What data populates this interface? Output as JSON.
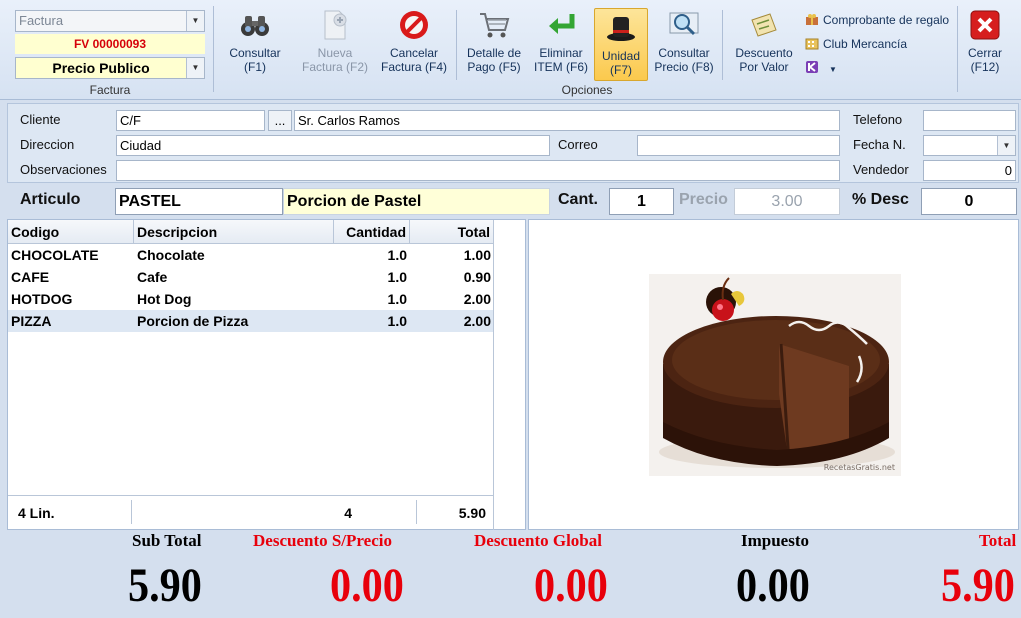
{
  "colors": {
    "accent_red": "#e8000b",
    "ribbon_bg": "#dbe6f4",
    "selected_button": "#fbd363"
  },
  "factura": {
    "doc_type": "Factura",
    "number": "FV 00000093",
    "price_list": "Precio Publico",
    "group_label": "Factura"
  },
  "toolbar": {
    "consultar": "Consultar\n(F1)",
    "nueva": "Nueva\nFactura (F2)",
    "cancelar": "Cancelar\nFactura (F4)",
    "detalle": "Detalle de\nPago (F5)",
    "eliminar": "Eliminar\nITEM (F6)",
    "unidad": "Unidad\n(F7)",
    "consultar_precio": "Consultar\nPrecio (F8)",
    "descuento": "Descuento\nPor Valor",
    "comprobante": "Comprobante de regalo",
    "club": "Club Mercancía",
    "cerrar": "Cerrar\n(F12)",
    "group_label": "Opciones",
    "icons": [
      "binoculars-icon",
      "new-document-icon",
      "cancel-icon",
      "cart-icon",
      "undo-arrow-icon",
      "top-hat-icon",
      "magnifier-icon",
      "discount-ticket-icon",
      "gift-icon",
      "building-icon",
      "k-logo-icon",
      "close-icon"
    ]
  },
  "client": {
    "cliente_label": "Cliente",
    "cliente_code": "C/F",
    "browse": "...",
    "cliente_name": "Sr. Carlos Ramos",
    "direccion_label": "Direccion",
    "direccion": "Ciudad",
    "correo_label": "Correo",
    "correo": "",
    "observaciones_label": "Observaciones",
    "observaciones": "",
    "telefono_label": "Telefono",
    "telefono": "",
    "fecha_label": "Fecha N.",
    "fecha": "",
    "vendedor_label": "Vendedor",
    "vendedor": "0"
  },
  "article": {
    "label": "Articulo",
    "code": "PASTEL",
    "description": "Porcion de Pastel",
    "cant_label": "Cant.",
    "cant": "1",
    "precio_label": "Precio",
    "precio": "3.00",
    "desc_label": "% Desc",
    "desc": "0"
  },
  "grid": {
    "headers": [
      "Codigo",
      "Descripcion",
      "Cantidad",
      "Total"
    ],
    "rows": [
      [
        "CHOCOLATE",
        "Chocolate",
        "1.0",
        "1.00"
      ],
      [
        "CAFE",
        "Cafe",
        "1.0",
        "0.90"
      ],
      [
        "HOTDOG",
        "Hot Dog",
        "1.0",
        "2.00"
      ],
      [
        "PIZZA",
        "Porcion de Pizza",
        "1.0",
        "2.00"
      ]
    ],
    "footer_lines": "4 Lin.",
    "footer_qty": "4",
    "footer_total": "5.90"
  },
  "totals": {
    "subtotal_label": "Sub Total",
    "subtotal": "5.90",
    "desc_precio_label": "Descuento S/Precio",
    "desc_precio": "0.00",
    "desc_global_label": "Descuento Global",
    "desc_global": "0.00",
    "impuesto_label": "Impuesto",
    "impuesto": "0.00",
    "total_label": "Total",
    "total": "5.90"
  },
  "image": {
    "watermark": "RecetasGratis.net"
  }
}
